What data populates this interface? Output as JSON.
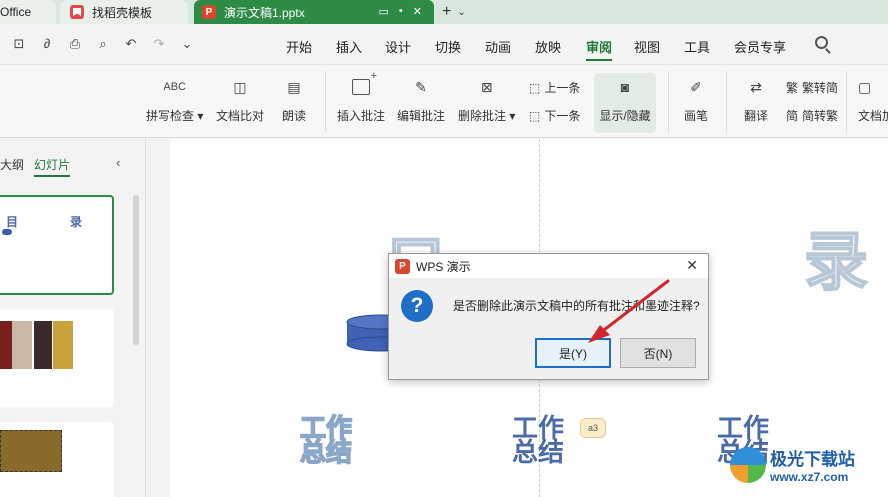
{
  "tabs": [
    {
      "label": "Office"
    },
    {
      "label": "找稻壳模板"
    },
    {
      "label": "演示文稿1.pptx"
    }
  ],
  "doc_icon_letter": "P",
  "menu": [
    "开始",
    "插入",
    "设计",
    "切换",
    "动画",
    "放映",
    "审阅",
    "视图",
    "工具",
    "会员专享"
  ],
  "active_menu": "审阅",
  "ribbon": {
    "spellcheck": "拼写检查",
    "spellcheck_icon_text": "ABC",
    "compare": "文档比对",
    "read_aloud": "朗读",
    "insert_comment": "插入批注",
    "edit_comment": "编辑批注",
    "delete_comment": "删除批注",
    "prev": "上一条",
    "next": "下一条",
    "show_hide": "显示/隐藏",
    "pen": "画笔",
    "translate": "翻译",
    "trad_to_simp": "繁转简",
    "simp_to_trad": "简转繁",
    "doc_protect": "文档加"
  },
  "left_panel": {
    "tab_outline": "大纲",
    "tab_slides": "幻灯片",
    "thumb1_title_left": "目",
    "thumb1_title_right": "录"
  },
  "canvas": {
    "big_char_left": "目",
    "big_char_right": "录",
    "block1_line1": "工作",
    "block1_line2": "总结",
    "block2_line1": "工作",
    "block2_line2": "总结",
    "block3_line1": "工作",
    "block3_line2": "总结",
    "annotation_label": "a3"
  },
  "dialog": {
    "title": "WPS 演示",
    "message": "是否删除此演示文稿中的所有批注和墨迹注释?",
    "yes": "是(Y)",
    "no": "否(N)"
  },
  "watermark": {
    "title": "极光下载站",
    "url": "www.xz7.com"
  },
  "colors": {
    "accent": "#1f7a3a",
    "active_tab": "#2e8b45",
    "dialog_primary_border": "#1a6fc9",
    "arrow": "#d0262c"
  }
}
